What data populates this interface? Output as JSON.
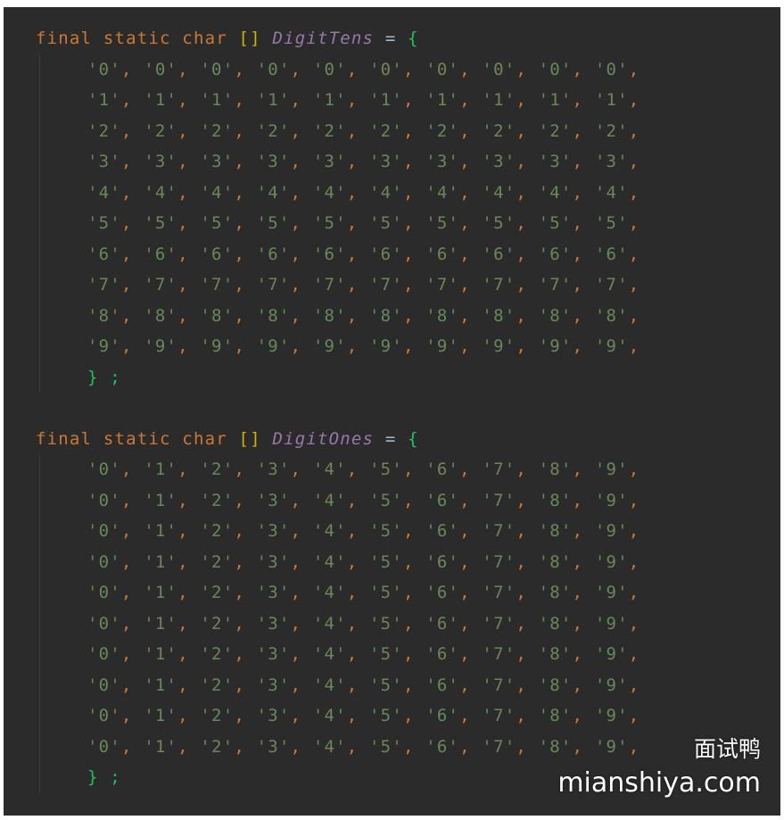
{
  "code": {
    "blocks": [
      {
        "keywords": "final static char",
        "brackets": "[]",
        "name": "DigitTens",
        "operator": "=",
        "open_brace": "{",
        "rows": [
          [
            "0",
            "0",
            "0",
            "0",
            "0",
            "0",
            "0",
            "0",
            "0",
            "0"
          ],
          [
            "1",
            "1",
            "1",
            "1",
            "1",
            "1",
            "1",
            "1",
            "1",
            "1"
          ],
          [
            "2",
            "2",
            "2",
            "2",
            "2",
            "2",
            "2",
            "2",
            "2",
            "2"
          ],
          [
            "3",
            "3",
            "3",
            "3",
            "3",
            "3",
            "3",
            "3",
            "3",
            "3"
          ],
          [
            "4",
            "4",
            "4",
            "4",
            "4",
            "4",
            "4",
            "4",
            "4",
            "4"
          ],
          [
            "5",
            "5",
            "5",
            "5",
            "5",
            "5",
            "5",
            "5",
            "5",
            "5"
          ],
          [
            "6",
            "6",
            "6",
            "6",
            "6",
            "6",
            "6",
            "6",
            "6",
            "6"
          ],
          [
            "7",
            "7",
            "7",
            "7",
            "7",
            "7",
            "7",
            "7",
            "7",
            "7"
          ],
          [
            "8",
            "8",
            "8",
            "8",
            "8",
            "8",
            "8",
            "8",
            "8",
            "8"
          ],
          [
            "9",
            "9",
            "9",
            "9",
            "9",
            "9",
            "9",
            "9",
            "9",
            "9"
          ]
        ],
        "close": "} ;"
      },
      {
        "keywords": "final static char",
        "brackets": "[]",
        "name": "DigitOnes",
        "operator": "=",
        "open_brace": "{",
        "rows": [
          [
            "0",
            "1",
            "2",
            "3",
            "4",
            "5",
            "6",
            "7",
            "8",
            "9"
          ],
          [
            "0",
            "1",
            "2",
            "3",
            "4",
            "5",
            "6",
            "7",
            "8",
            "9"
          ],
          [
            "0",
            "1",
            "2",
            "3",
            "4",
            "5",
            "6",
            "7",
            "8",
            "9"
          ],
          [
            "0",
            "1",
            "2",
            "3",
            "4",
            "5",
            "6",
            "7",
            "8",
            "9"
          ],
          [
            "0",
            "1",
            "2",
            "3",
            "4",
            "5",
            "6",
            "7",
            "8",
            "9"
          ],
          [
            "0",
            "1",
            "2",
            "3",
            "4",
            "5",
            "6",
            "7",
            "8",
            "9"
          ],
          [
            "0",
            "1",
            "2",
            "3",
            "4",
            "5",
            "6",
            "7",
            "8",
            "9"
          ],
          [
            "0",
            "1",
            "2",
            "3",
            "4",
            "5",
            "6",
            "7",
            "8",
            "9"
          ],
          [
            "0",
            "1",
            "2",
            "3",
            "4",
            "5",
            "6",
            "7",
            "8",
            "9"
          ],
          [
            "0",
            "1",
            "2",
            "3",
            "4",
            "5",
            "6",
            "7",
            "8",
            "9"
          ]
        ],
        "close": "} ;"
      }
    ]
  },
  "watermark": {
    "line1": "面试鸭",
    "line2": "mianshiya.com"
  },
  "colors": {
    "background": "#2b2b2b",
    "keyword": "#cc7832",
    "brackets": "#d4b000",
    "field_name": "#9876aa",
    "brace": "#23c25b",
    "char_literal": "#6a8759"
  }
}
